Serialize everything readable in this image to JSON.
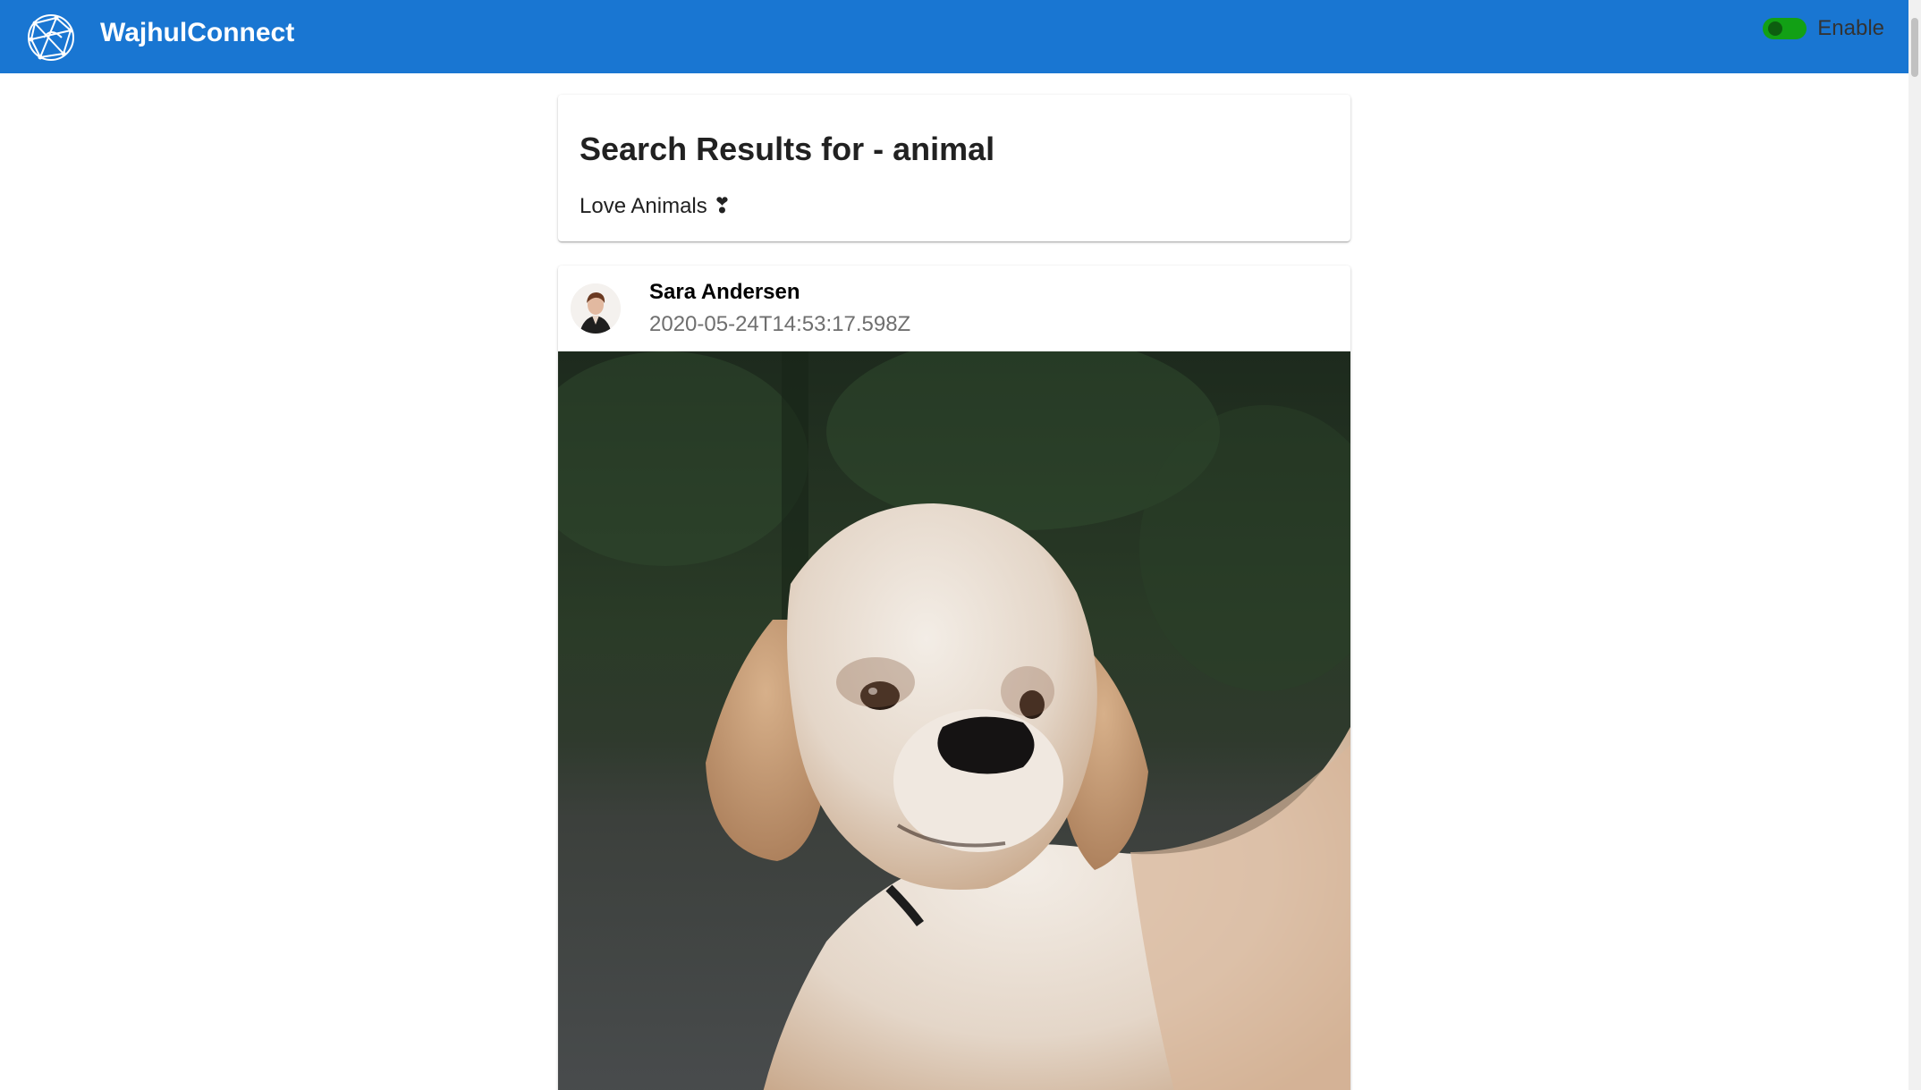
{
  "header": {
    "brand": "WajhulConnect",
    "toggle_label": "Enable",
    "toggle_state": "on",
    "bar_color": "#1976d2",
    "toggle_color": "#12a015"
  },
  "search": {
    "title": "Search Results for - animal",
    "subtitle": "Love Animals ❣"
  },
  "post": {
    "author": "Sara Andersen",
    "timestamp": "2020-05-24T14:53:17.598Z"
  },
  "icons": {
    "logo": "globe-network-icon"
  }
}
